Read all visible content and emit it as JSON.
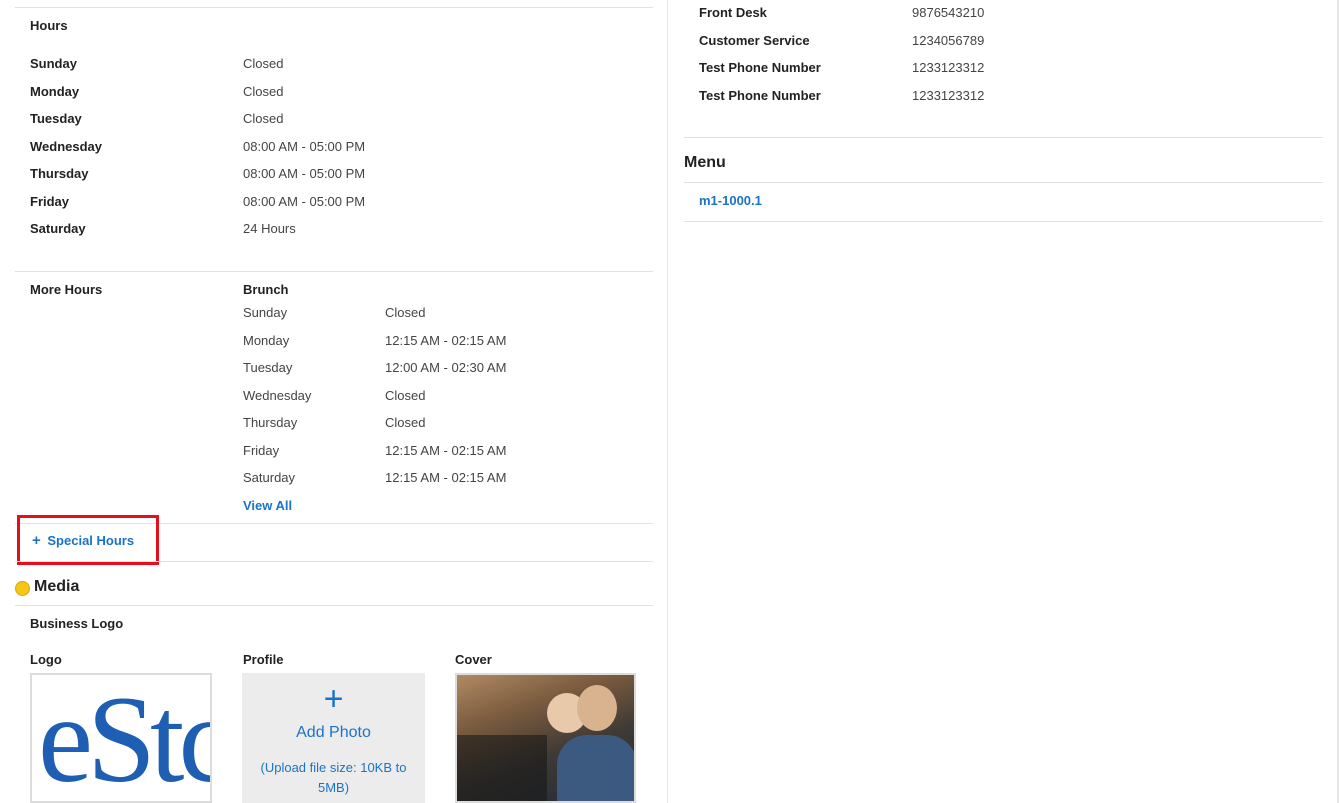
{
  "hours": {
    "title": "Hours",
    "rows": [
      {
        "day": "Sunday",
        "value": "Closed"
      },
      {
        "day": "Monday",
        "value": "Closed"
      },
      {
        "day": "Tuesday",
        "value": "Closed"
      },
      {
        "day": "Wednesday",
        "value": "08:00 AM - 05:00 PM"
      },
      {
        "day": "Thursday",
        "value": "08:00 AM - 05:00 PM"
      },
      {
        "day": "Friday",
        "value": "08:00 AM - 05:00 PM"
      },
      {
        "day": "Saturday",
        "value": "24 Hours"
      }
    ]
  },
  "more_hours": {
    "title": "More Hours",
    "group": "Brunch",
    "rows": [
      {
        "day": "Sunday",
        "value": "Closed"
      },
      {
        "day": "Monday",
        "value": "12:15 AM - 02:15 AM"
      },
      {
        "day": "Tuesday",
        "value": "12:00 AM - 02:30 AM"
      },
      {
        "day": "Wednesday",
        "value": "Closed"
      },
      {
        "day": "Thursday",
        "value": "Closed"
      },
      {
        "day": "Friday",
        "value": "12:15 AM - 02:15 AM"
      },
      {
        "day": "Saturday",
        "value": "12:15 AM - 02:15 AM"
      }
    ],
    "view_all": "View All"
  },
  "special_hours": {
    "plus": "+",
    "label": "Special Hours"
  },
  "media": {
    "title": "Media",
    "business_logo": "Business Logo",
    "logo_label": "Logo",
    "logo_text": "eStc",
    "profile_label": "Profile",
    "add_plus": "+",
    "add_photo": "Add Photo",
    "upload_note": "(Upload file size: 10KB to 5MB)",
    "cover_label": "Cover"
  },
  "phones": [
    {
      "label": "Front Desk",
      "value": "9876543210"
    },
    {
      "label": "Customer Service",
      "value": "1234056789"
    },
    {
      "label": "Test Phone Number",
      "value": "1233123312"
    },
    {
      "label": "Test Phone Number",
      "value": "1233123312"
    }
  ],
  "menu": {
    "title": "Menu",
    "item": "m1-1000.1"
  },
  "colors": {
    "link": "#1a73c8",
    "highlight": "#e3101c",
    "status_dot": "#f5c518"
  }
}
